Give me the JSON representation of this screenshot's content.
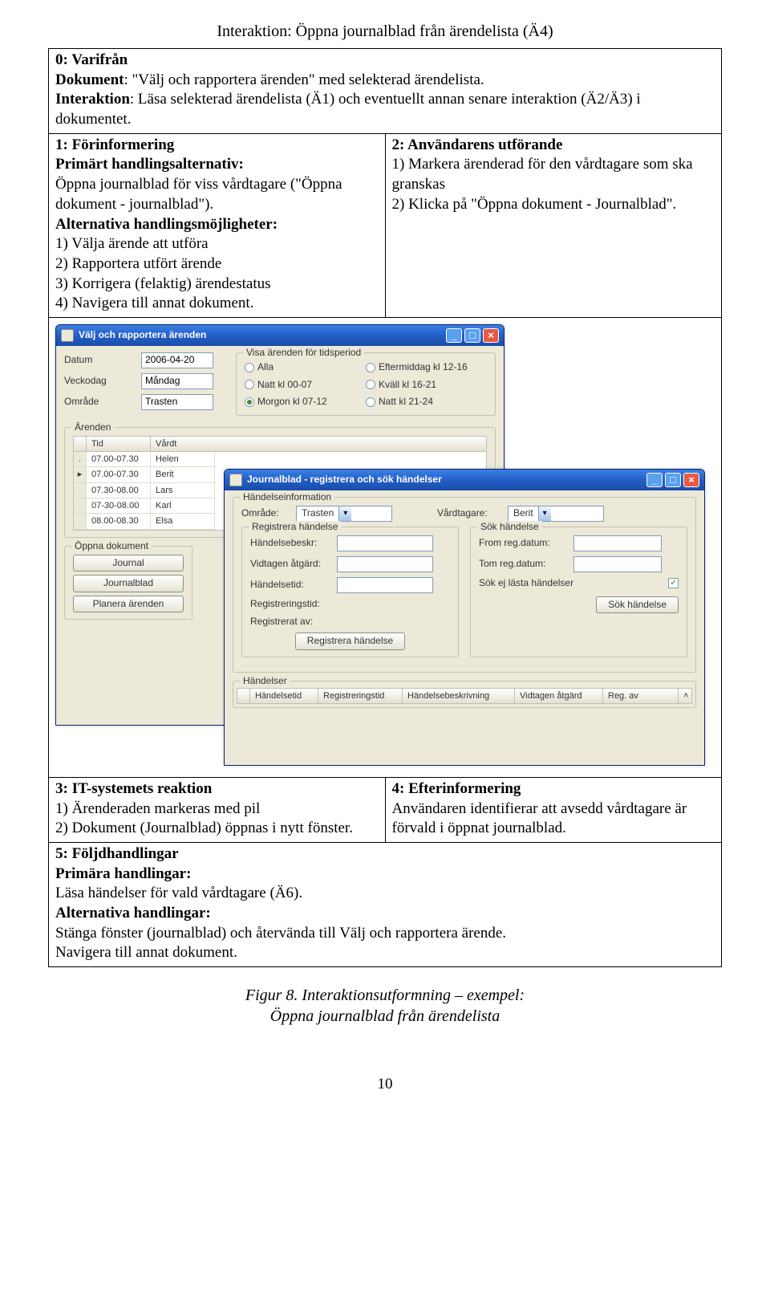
{
  "title": "Interaktion: Öppna journalblad från ärendelista (Ä4)",
  "row0": {
    "heading": "0: Varifrån",
    "l1a": "Dokument",
    "l1b": ": \"Välj och rapportera ärenden\" med selekterad ärendelista.",
    "l2a": "Interaktion",
    "l2b": ": Läsa selekterad ärendelista (Ä1) och eventuellt annan senare interaktion (Ä2/Ä3) i dokumentet."
  },
  "row1": {
    "left": {
      "h": "1: Förinformering",
      "b1l": "Primärt handlingsalternativ:",
      "b1t": "Öppna journalblad för viss vårdtagare (\"Öppna dokument - journalblad\").",
      "b2l": "Alternativa handlingsmöjligheter:",
      "li1": "1) Välja ärende att utföra",
      "li2": "2) Rapportera utfört ärende",
      "li3": "3) Korrigera (felaktig) ärendestatus",
      "li4": "4) Navigera till annat dokument."
    },
    "right": {
      "h": "2: Användarens utförande",
      "li1": "1) Markera ärenderad för den vårdtagare som ska granskas",
      "li2": "2) Klicka på \"Öppna dokument - Journalblad\"."
    }
  },
  "row3": {
    "left": {
      "h": "3: IT-systemets reaktion",
      "li1": "1) Ärenderaden markeras med pil",
      "li2": "2) Dokument (Journalblad) öppnas i nytt fönster."
    },
    "right": {
      "h": "4: Efterinformering",
      "t": "Användaren identifierar att avsedd vårdtagare är förvald i öppnat journalblad."
    }
  },
  "row5": {
    "h": "5: Följdhandlingar",
    "b1l": "Primära handlingar:",
    "b1t": "Läsa händelser för vald vårdtagare (Ä6).",
    "b2l": "Alternativa handlingar:",
    "b2t1": "Stänga fönster (journalblad) och återvända till Välj och rapportera ärende.",
    "b2t2": "Navigera till annat dokument."
  },
  "figcap1": "Figur 8. Interaktionsutformning – exempel:",
  "figcap2": "Öppna journalblad från ärendelista",
  "pagenum": "10",
  "win1": {
    "title": "Välj och rapportera ärenden",
    "datum_l": "Datum",
    "datum_v": "2006-04-20",
    "veckodag_l": "Veckodag",
    "veckodag_v": "Måndag",
    "omrade_l": "Område",
    "omrade_v": "Trasten",
    "group_period": "Visa ärenden för tidsperiod",
    "r_alla": "Alla",
    "r_natt0": "Natt kl 00-07",
    "r_morg": "Morgon kl 07-12",
    "r_em": "Eftermiddag kl 12-16",
    "r_kvall": "Kväll kl 16-21",
    "r_natt21": "Natt kl 21-24",
    "arenden_grp": "Ärenden",
    "col_tid": "Tid",
    "col_vt": "Vårdt",
    "rows": [
      {
        "tid": "07.00-07.30",
        "vt": "Helen"
      },
      {
        "tid": "07.00-07.30",
        "vt": "Berit"
      },
      {
        "tid": "07.30-08.00",
        "vt": "Lars"
      },
      {
        "tid": "07-30-08.00",
        "vt": "Karl"
      },
      {
        "tid": "08.00-08.30",
        "vt": "Elsa"
      }
    ],
    "opendoc_grp": "Öppna dokument",
    "btn_journal": "Journal",
    "btn_jblad": "Journalblad",
    "btn_plan": "Planera ärenden"
  },
  "win2": {
    "title": "Journalblad - registrera och sök händelser",
    "hinfo_grp": "Händelseinformation",
    "omrade_l": "Område:",
    "omrade_v": "Trasten",
    "vt_l": "Vårdtagare:",
    "vt_v": "Berit",
    "reg_grp": "Registrera händelse",
    "hbeskr": "Händelsebeskr:",
    "atgard": "Vidtagen åtgärd:",
    "htid": "Händelsetid:",
    "regtid": "Registreringstid:",
    "regav": "Registrerat av:",
    "btn_reg": "Registrera händelse",
    "sok_grp": "Sök händelse",
    "from": "From reg.datum:",
    "tom": "Tom reg.datum:",
    "ej_lasta": "Sök ej lästa händelser",
    "btn_sok": "Sök händelse",
    "hand_grp": "Händelser",
    "c1": "Händelsetid",
    "c2": "Registreringstid",
    "c3": "Händelsebeskrivning",
    "c4": "Vidtagen åtgärd",
    "c5": "Reg. av"
  }
}
